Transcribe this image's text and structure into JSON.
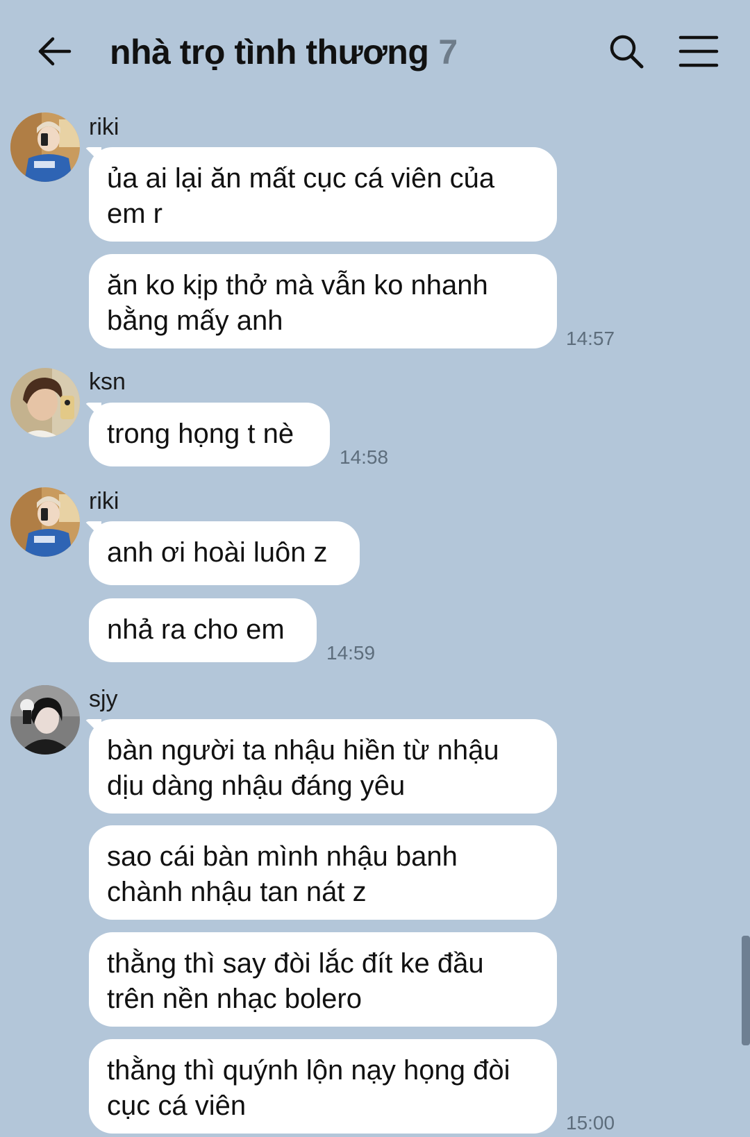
{
  "header": {
    "title": "nhà trọ tình thương",
    "member_count": "7",
    "back_icon": "back-arrow-icon",
    "search_icon": "search-icon",
    "menu_icon": "hamburger-menu-icon"
  },
  "colors": {
    "background": "#b3c6d9",
    "bubble": "#ffffff",
    "timestamp": "#5d6d7c"
  },
  "groups": [
    {
      "sender": "riki",
      "messages": [
        "ủa ai lại ăn mất cục cá viên của em r",
        "ăn ko kịp thở mà vẫn ko nhanh bằng mấy anh"
      ],
      "time": "14:57"
    },
    {
      "sender": "ksn",
      "messages": [
        "trong họng t nè"
      ],
      "time": "14:58"
    },
    {
      "sender": "riki",
      "messages": [
        "anh ơi hoài luôn z",
        "nhả ra cho em"
      ],
      "time": "14:59"
    },
    {
      "sender": "sjy",
      "messages": [
        "bàn người ta nhậu hiền từ nhậu dịu dàng nhậu đáng yêu",
        "sao cái bàn mình nhậu banh chành nhậu tan nát z",
        "thằng thì say đòi lắc đít ke đầu trên nền nhạc bolero",
        "thằng thì quýnh lộn nạy họng đòi cục cá viên"
      ],
      "time": "15:00"
    }
  ]
}
